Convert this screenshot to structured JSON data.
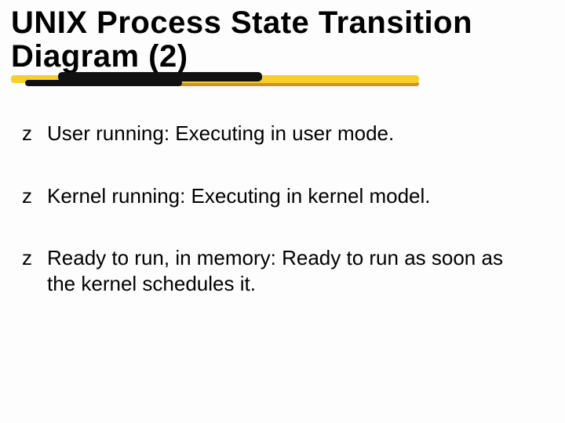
{
  "slide": {
    "title": "UNIX Process State Transition Diagram (2)"
  },
  "bullets": {
    "glyph": "z",
    "items": [
      "User running: Executing in user mode.",
      "Kernel running: Executing in kernel model.",
      "Ready to run, in memory: Ready to run as soon as the kernel schedules it."
    ]
  }
}
